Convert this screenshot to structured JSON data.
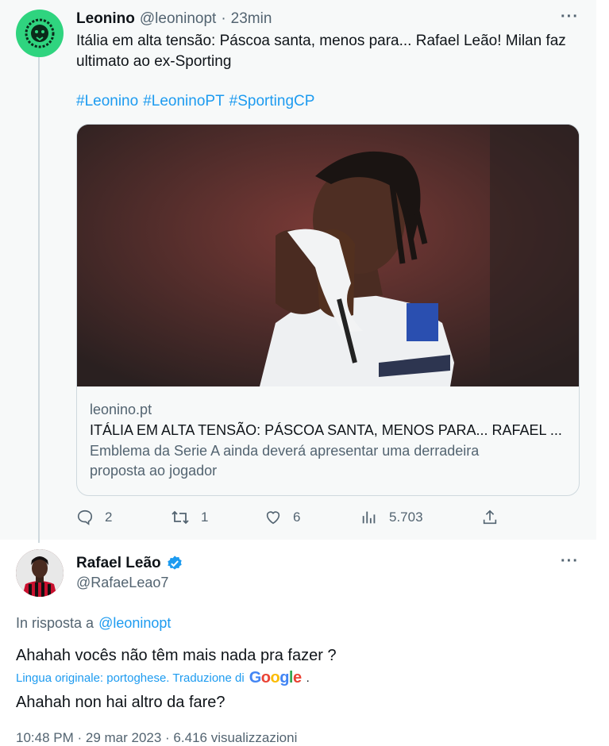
{
  "tweet1": {
    "author_name": "Leonino",
    "handle": "@leoninopt",
    "sep": "·",
    "time": "23min",
    "text_line1": "Itália em alta tensão: Páscoa santa, menos para... Rafael Leão! Milan faz",
    "text_line2": "ultimato ao ex-Sporting",
    "hashtags": [
      "#Leonino",
      "#LeoninoPT",
      "#SportingCP"
    ],
    "card": {
      "domain": "leonino.pt",
      "title": "ITÁLIA EM ALTA TENSÃO: PÁSCOA SANTA, MENOS PARA... RAFAEL ...",
      "desc_line1": "Emblema da Serie A ainda deverá apresentar uma derradeira",
      "desc_line2": "proposta ao jogador"
    },
    "actions": {
      "replies": "2",
      "retweets": "1",
      "likes": "6",
      "views": "5.703"
    },
    "more": "···"
  },
  "tweet2": {
    "author_name": "Rafael Leão",
    "handle": "@RafaeLeao7",
    "more": "···",
    "reply_to_prefix": "In risposta a",
    "reply_to_handle": "@leoninopt",
    "text": "Ahahah vocês não têm mais nada pra fazer ?",
    "translation_note": "Lingua originale: portoghese. Traduzione di",
    "google_letters": [
      "G",
      "o",
      "o",
      "g",
      "l",
      "e"
    ],
    "google_colors": [
      "#4285f4",
      "#ea4335",
      "#fbbc05",
      "#4285f4",
      "#34a853",
      "#ea4335"
    ],
    "translated": "Ahahah non hai altro da fare?",
    "footer_partial": "10:48 PM · 29 mar 2023 · 6.416 visualizzazioni"
  },
  "colors": {
    "accent": "#1d9bf0",
    "leonino_green": "#2fd47f",
    "verified": "#1d9bf0"
  }
}
